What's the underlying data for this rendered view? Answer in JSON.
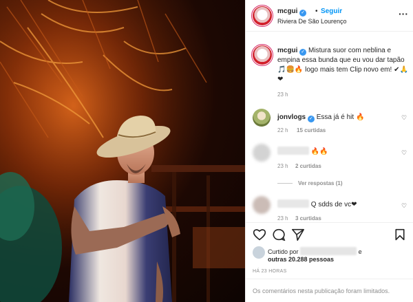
{
  "post": {
    "username": "mcgui",
    "follow_label": "Seguir",
    "separator": "•",
    "location": "Riviera De São Lourenço",
    "more_icon": "more-options-icon"
  },
  "caption": {
    "username": "mcgui",
    "text": "Mistura suor com neblina e empina essa bunda que eu vou dar tapão 🎵🍔🔥 logo mais tem Clip novo em! ✔🙏❤",
    "time": "23 h"
  },
  "comments": [
    {
      "username": "jonvlogs",
      "text": "Essa já é hit 🔥",
      "time": "22 h",
      "likes": "15 curtidas"
    },
    {
      "username": "",
      "text": "🔥🔥",
      "time": "23 h",
      "likes": "2 curtidas",
      "replies": "Ver respostas (1)"
    },
    {
      "username": "",
      "text": "Q sdds de vc❤",
      "time": "23 h",
      "likes": "3 curtidas"
    }
  ],
  "likes": {
    "prefix": "Curtido por",
    "and": "e",
    "others": "outras 20.288 pessoas"
  },
  "timestamp": "HÁ 23 HORAS",
  "comments_limited": "Os comentários nesta publicação foram limitados.",
  "colors": {
    "accent": "#0095f6",
    "verified": "#3897f0",
    "secondary_text": "#8e8e8e",
    "border": "#efefef"
  },
  "icons": [
    "like-icon",
    "comment-icon",
    "share-icon",
    "save-icon",
    "heart-icon",
    "verified-icon"
  ]
}
